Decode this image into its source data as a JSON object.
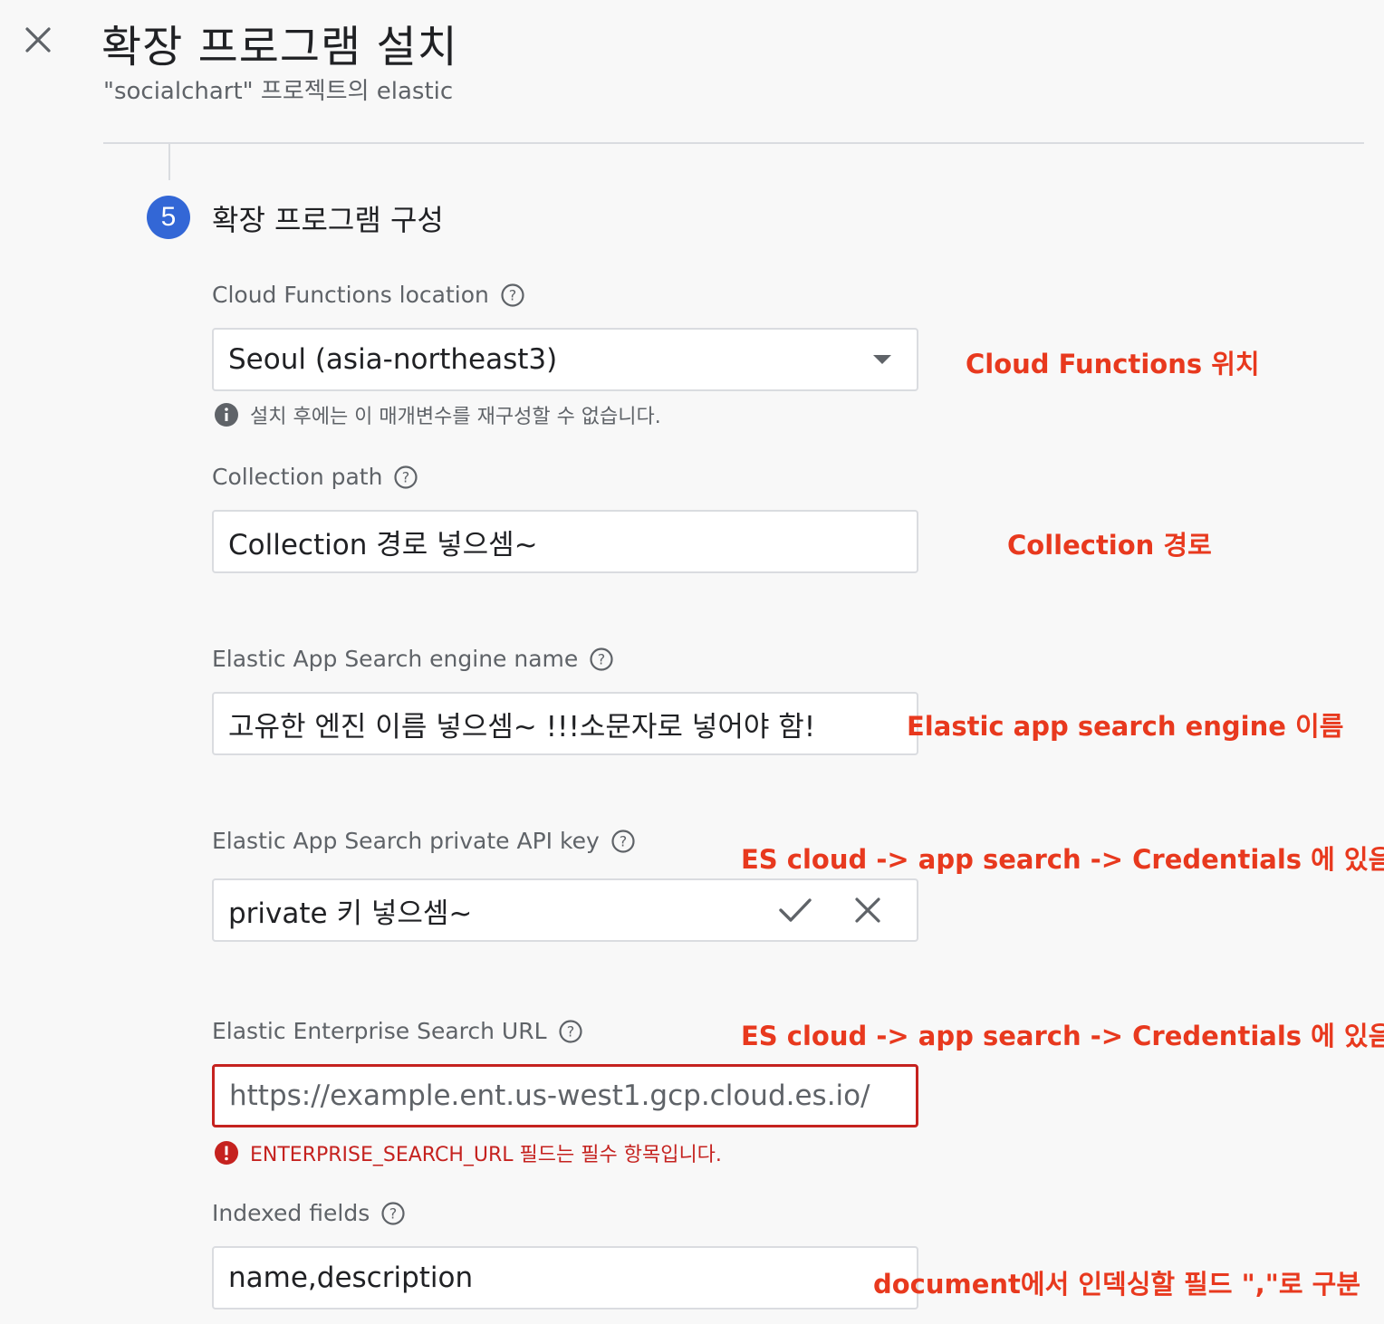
{
  "header": {
    "title": "확장 프로그램 설치",
    "subtitle": "\"socialchart\" 프로젝트의 elastic"
  },
  "step": {
    "number": "5",
    "title": "확장 프로그램 구성",
    "badge_color": "#3367d6"
  },
  "fields": [
    {
      "label": "Cloud Functions location",
      "value": "Seoul (asia-northeast3)",
      "type": "select",
      "hint": "설치 후에는 이 매개변수를 재구성할 수 없습니다.",
      "hint_icon": "info-icon"
    },
    {
      "label": "Collection path",
      "value": "Collection 경로 넣으셈~",
      "type": "text"
    },
    {
      "label": "Elastic App Search engine name",
      "value": "고유한 엔진 이름 넣으셈~ !!!소문자로 넣어야 함!",
      "type": "text"
    },
    {
      "label": "Elastic App Search private API key",
      "value": "private 키 넣으셈~",
      "type": "secret",
      "actions": [
        "check-icon",
        "close-icon"
      ]
    },
    {
      "label": "Elastic Enterprise Search URL",
      "placeholder": "https://example.ent.us-west1.gcp.cloud.es.io/",
      "type": "text",
      "state": "error",
      "hint": "ENTERPRISE_SEARCH_URL 필드는 필수 항목입니다.",
      "hint_icon": "error-icon"
    },
    {
      "label": "Indexed fields",
      "value": "name,description",
      "type": "text"
    }
  ],
  "annotations": {
    "location": "Cloud Functions 위치",
    "collection": "Collection 경로",
    "engine": "Elastic app search engine 이름",
    "api_key": "ES cloud -> app search -> Credentials 에 있음",
    "url": "ES cloud -> app search -> Credentials 에 있음",
    "indexed": "document에서 인덱싱할 필드 \",\"로 구분"
  },
  "colors": {
    "annotation": "#e8391e",
    "error": "#c5221f",
    "accent": "#3367d6"
  }
}
